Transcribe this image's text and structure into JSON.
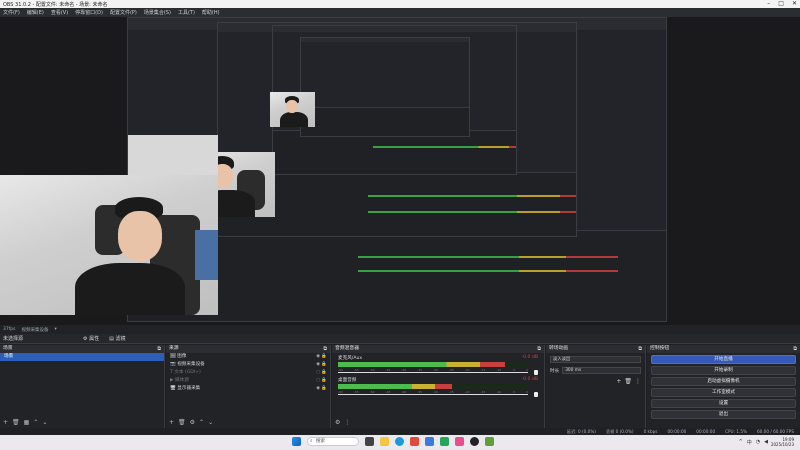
{
  "window": {
    "title": "OBS 31.0.2 - 配置文件: 未命名 - 场景: 未命名",
    "controls": [
      "–",
      "□",
      "✕"
    ]
  },
  "menu": [
    "文件(F)",
    "编辑(E)",
    "查看(V)",
    "停靠窗口(D)",
    "配置文件(P)",
    "场景集合(S)",
    "工具(T)",
    "帮助(H)"
  ],
  "status_line": {
    "fps": "37fps",
    "source": "视频采集设备"
  },
  "dock_tabs": {
    "no_source": "未选择源",
    "properties": "属性",
    "filters": "滤镜"
  },
  "scenes": {
    "title": "场景",
    "items": [
      "场景"
    ]
  },
  "sources": {
    "title": "来源",
    "items": [
      {
        "label": "图像"
      },
      {
        "label": "视频采集设备"
      },
      {
        "label": "文本 (GDI+)"
      },
      {
        "label": "媒体源"
      },
      {
        "label": "显示器采集"
      }
    ]
  },
  "mixer": {
    "title": "音频混音器",
    "tracks": [
      {
        "label": "麦克风/Aux",
        "db": "-0.0 dB",
        "level": 0.88
      },
      {
        "label": "桌面音频",
        "db": "-0.0 dB",
        "level": 0.6
      }
    ],
    "scale": [
      "-60",
      "-55",
      "-50",
      "-45",
      "-40",
      "-35",
      "-30",
      "-25",
      "-20",
      "-15",
      "-10",
      "-5",
      "0"
    ]
  },
  "transitions": {
    "title": "转场动画",
    "type": "淡入淡出",
    "duration_label": "时长",
    "duration": "300 ms"
  },
  "controls": {
    "title": "控制按钮",
    "buttons": [
      "开始直播",
      "开始录制",
      "启动虚拟摄像机",
      "工作室模式",
      "设置",
      "退出"
    ]
  },
  "bottom_status": [
    "延迟: 0 (0.0%)",
    "丢帧 0 (0.0%)",
    "0 kbps",
    "00:00:00",
    "00:00:00",
    "CPU: 1.5%",
    "60.00 / 60.00 FPS"
  ],
  "taskbar": {
    "search": "搜索",
    "time": "19:09",
    "date": "2025/10/23",
    "lang": "中"
  }
}
